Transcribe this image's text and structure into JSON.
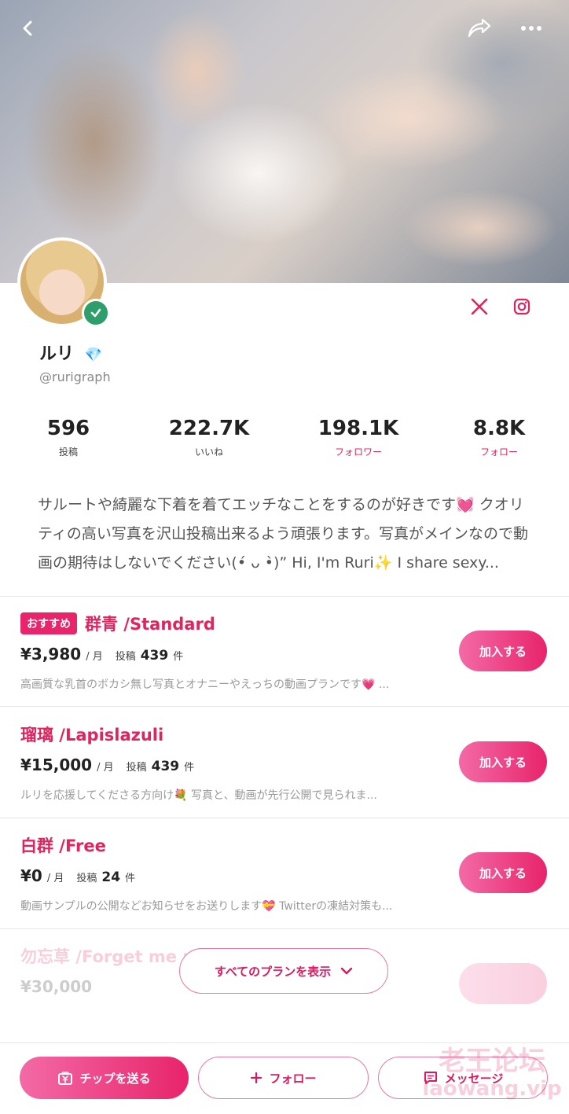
{
  "header": {
    "back_icon": "chevron-left-icon",
    "share_icon": "share-icon",
    "more_icon": "more-icon"
  },
  "profile": {
    "name": "ルリ",
    "name_badge_icon": "diamond-icon",
    "handle": "@rurigraph",
    "verified_icon": "check-icon",
    "social": {
      "x_icon": "x-logo-icon",
      "instagram_icon": "instagram-icon"
    }
  },
  "stats": [
    {
      "value": "596",
      "label": "投稿"
    },
    {
      "value": "222.7K",
      "label": "いいね"
    },
    {
      "value": "198.1K",
      "label": "フォロワー"
    },
    {
      "value": "8.8K",
      "label": "フォロー"
    }
  ],
  "bio": "サルートや綺麗な下着を着てエッチなことをするのが好きです💓 クオリティの高い写真を沢山投稿出来るよう頑張ります。写真がメインなので動画の期待はしないでください(•́ ᴗ •̀)” Hi, I'm Ruri✨ I share sexy...",
  "plans": [
    {
      "badge": "おすすめ",
      "name": "群青 /Standard",
      "price": "¥3,980",
      "per": "/ 月",
      "posts_label": "投稿",
      "posts_count": "439",
      "posts_unit": "件",
      "description": "高画質な乳首のボカシ無し写真とオナニーやえっちの動画プランです💗 ...",
      "join_label": "加入する"
    },
    {
      "name": "瑠璃 /Lapislazuli",
      "price": "¥15,000",
      "per": "/ 月",
      "posts_label": "投稿",
      "posts_count": "439",
      "posts_unit": "件",
      "description": "ルリを応援してくださる方向け💐 写真と、動画が先行公開で見られま...",
      "join_label": "加入する"
    },
    {
      "name": "白群 /Free",
      "price": "¥0",
      "per": "/ 月",
      "posts_label": "投稿",
      "posts_count": "24",
      "posts_unit": "件",
      "description": "動画サンプルの公開などお知らせをお送りします💝 Twitterの凍結対策も...",
      "join_label": "加入する"
    },
    {
      "name": "勿忘草 /Forget me n",
      "price": "¥30,000"
    }
  ],
  "show_all": {
    "label": "すべてのプランを表示",
    "icon": "chevron-down-icon"
  },
  "bottom_bar": {
    "tip_label": "チップを送る",
    "tip_icon": "yen-gift-icon",
    "follow_label": "フォロー",
    "follow_icon": "plus-icon",
    "message_label": "メッセージ",
    "message_icon": "chat-icon"
  },
  "watermark": {
    "line1": "老王论坛",
    "line2": "laowang.vip"
  },
  "colors": {
    "accent": "#e0245e",
    "verified": "#2e9e6a"
  }
}
